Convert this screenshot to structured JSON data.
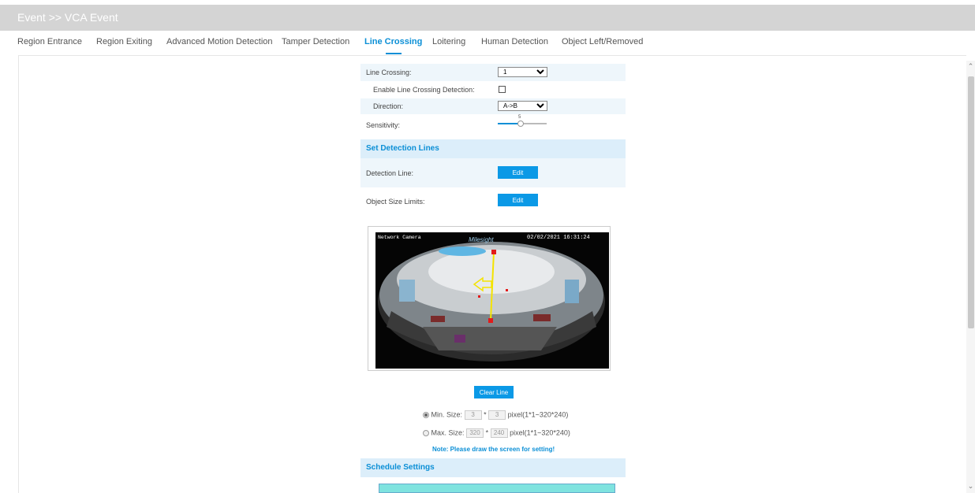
{
  "header": {
    "title": "Event >> VCA Event"
  },
  "tabs": [
    {
      "label": "Region Entrance",
      "active": false
    },
    {
      "label": "Region Exiting",
      "active": false
    },
    {
      "label": "Advanced Motion Detection",
      "active": false
    },
    {
      "label": "Tamper Detection",
      "active": false
    },
    {
      "label": "Line Crossing",
      "active": true
    },
    {
      "label": "Loitering",
      "active": false
    },
    {
      "label": "Human Detection",
      "active": false
    },
    {
      "label": "Object Left/Removed",
      "active": false
    }
  ],
  "form": {
    "line_crossing_label": "Line Crossing:",
    "line_crossing_value": "1",
    "enable_label": "Enable Line Crossing Detection:",
    "enable_checked": false,
    "direction_label": "Direction:",
    "direction_value": "A->B",
    "sensitivity_label": "Sensitivity:",
    "sensitivity_value": "5",
    "sensitivity_fraction": 0.45
  },
  "detection_section": {
    "title": "Set Detection Lines",
    "detection_line_label": "Detection Line:",
    "object_size_label": "Object Size Limits:",
    "edit_label": "Edit"
  },
  "preview": {
    "overlay_left": "Network Camera",
    "overlay_right": "02/02/2021 16:31:24",
    "watermark": "Milesight",
    "clear_line_label": "Clear Line"
  },
  "size_limits": {
    "min_label": "Min. Size:",
    "min_w": "3",
    "min_h": "3",
    "max_label": "Max. Size:",
    "max_w": "320",
    "max_h": "240",
    "times": "*",
    "range_text": "pixel(1*1~320*240)",
    "note": "Note: Please draw the screen for setting!"
  },
  "schedule": {
    "title": "Schedule Settings"
  },
  "colors": {
    "accent": "#0b8fd6",
    "button": "#0b99e6",
    "section_bg": "#dceefa",
    "titlebar_bg": "#d4d4d4"
  }
}
